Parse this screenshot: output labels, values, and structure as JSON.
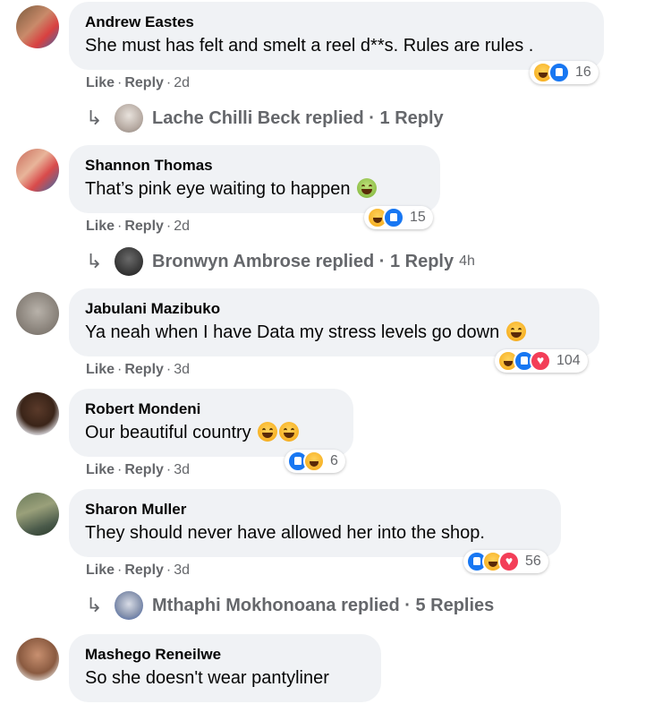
{
  "ui": {
    "like_label": "Like",
    "reply_label": "Reply",
    "separator": "·",
    "reply_arrow": "↳"
  },
  "colors": {
    "bubble_bg": "#f0f2f5",
    "secondary_text": "#65676b",
    "like_blue": "#1877f2",
    "love_red": "#f33e58",
    "haha_yellow": "#f7b125"
  },
  "comments": [
    {
      "author": "Andrew Eastes",
      "text": "She must has felt and smelt a reel d**s. Rules are rules .",
      "time": "2d",
      "reaction_icons": [
        "haha",
        "like"
      ],
      "reaction_count": "16",
      "reply_summary": {
        "text": "Lache Chilli Beck replied · 1 Reply",
        "time": ""
      }
    },
    {
      "author": "Shannon Thomas",
      "text": "That’s pink eye waiting to happen",
      "text_emoji": [
        "sick-face"
      ],
      "time": "2d",
      "reaction_icons": [
        "haha",
        "like"
      ],
      "reaction_count": "15",
      "reply_summary": {
        "text": "Bronwyn Ambrose replied · 1 Reply",
        "time": "4h"
      }
    },
    {
      "author": "Jabulani Mazibuko",
      "text": "Ya neah when I have Data my stress levels go down",
      "text_emoji": [
        "tears-of-joy"
      ],
      "time": "3d",
      "reaction_icons": [
        "haha",
        "like",
        "love"
      ],
      "reaction_count": "104"
    },
    {
      "author": "Robert Mondeni",
      "text": "Our beautiful country",
      "text_emoji": [
        "tears-of-joy",
        "tears-of-joy"
      ],
      "time": "3d",
      "reaction_icons": [
        "like",
        "haha"
      ],
      "reaction_count": "6"
    },
    {
      "author": "Sharon Muller",
      "text": "They should never have allowed her into the shop.",
      "time": "3d",
      "reaction_icons": [
        "like",
        "haha",
        "love"
      ],
      "reaction_count": "56",
      "reply_summary": {
        "text": "Mthaphi Mokhonoana replied · 5 Replies",
        "time": ""
      }
    },
    {
      "author": "Mashego Reneilwe",
      "text": "So she doesn't wear pantyliner"
    }
  ]
}
